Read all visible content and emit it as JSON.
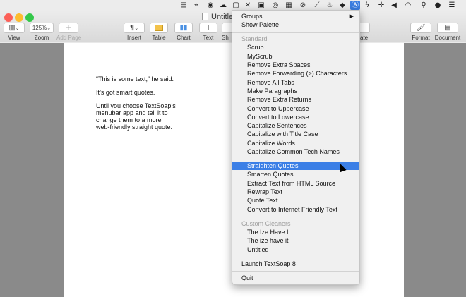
{
  "window": {
    "title": "Untitled"
  },
  "toolbar": {
    "view_label": "View",
    "zoom_value": "125%",
    "zoom_label": "Zoom",
    "add_page_label": "Add Page",
    "insert_label": "Insert",
    "table_label": "Table",
    "chart_label": "Chart",
    "text_label": "Text",
    "shape_partial_label": "Sh",
    "ate_partial_label": "ate",
    "format_label": "Format",
    "document_label": "Document"
  },
  "document": {
    "line1": "“This is some text,” he said.",
    "line2": "It’s got smart quotes.",
    "line3": "Until you choose TextSoap’s",
    "line4": "menubar app and tell it to",
    "line5": "change them to a more",
    "line6": "web-friendly straight quote."
  },
  "menu": {
    "groups": "Groups",
    "show_palette": "Show Palette",
    "standard_header": "Standard",
    "standard_items": [
      "Scrub",
      "MyScrub",
      "Remove Extra Spaces",
      "Remove Forwarding (>) Characters",
      "Remove All Tabs",
      "Make Paragraphs",
      "Remove Extra Returns",
      "Convert to Uppercase",
      "Convert to Lowercase",
      "Capitalize Sentences",
      "Capitalize with Title Case",
      "Capitalize Words",
      "Capitalize Common Tech Names"
    ],
    "quote_items": [
      "Straighten Quotes",
      "Smarten Quotes",
      "Extract Text from HTML Source",
      "Rewrap Text",
      "Quote Text",
      "Convert to Internet Friendly Text"
    ],
    "custom_header": "Custom Cleaners",
    "custom_items": [
      "The Ize Have It",
      "The ize have it",
      "Untitled"
    ],
    "launch": "Launch TextSoap 8",
    "quit": "Quit",
    "highlight_color": "#3b7fe6"
  },
  "colors": {
    "close": "#fc5f57",
    "minimize": "#fdbc2e",
    "zoom": "#34c84a",
    "chart_blue": "#4a90e2",
    "table_yellow": "#f3c24a"
  }
}
